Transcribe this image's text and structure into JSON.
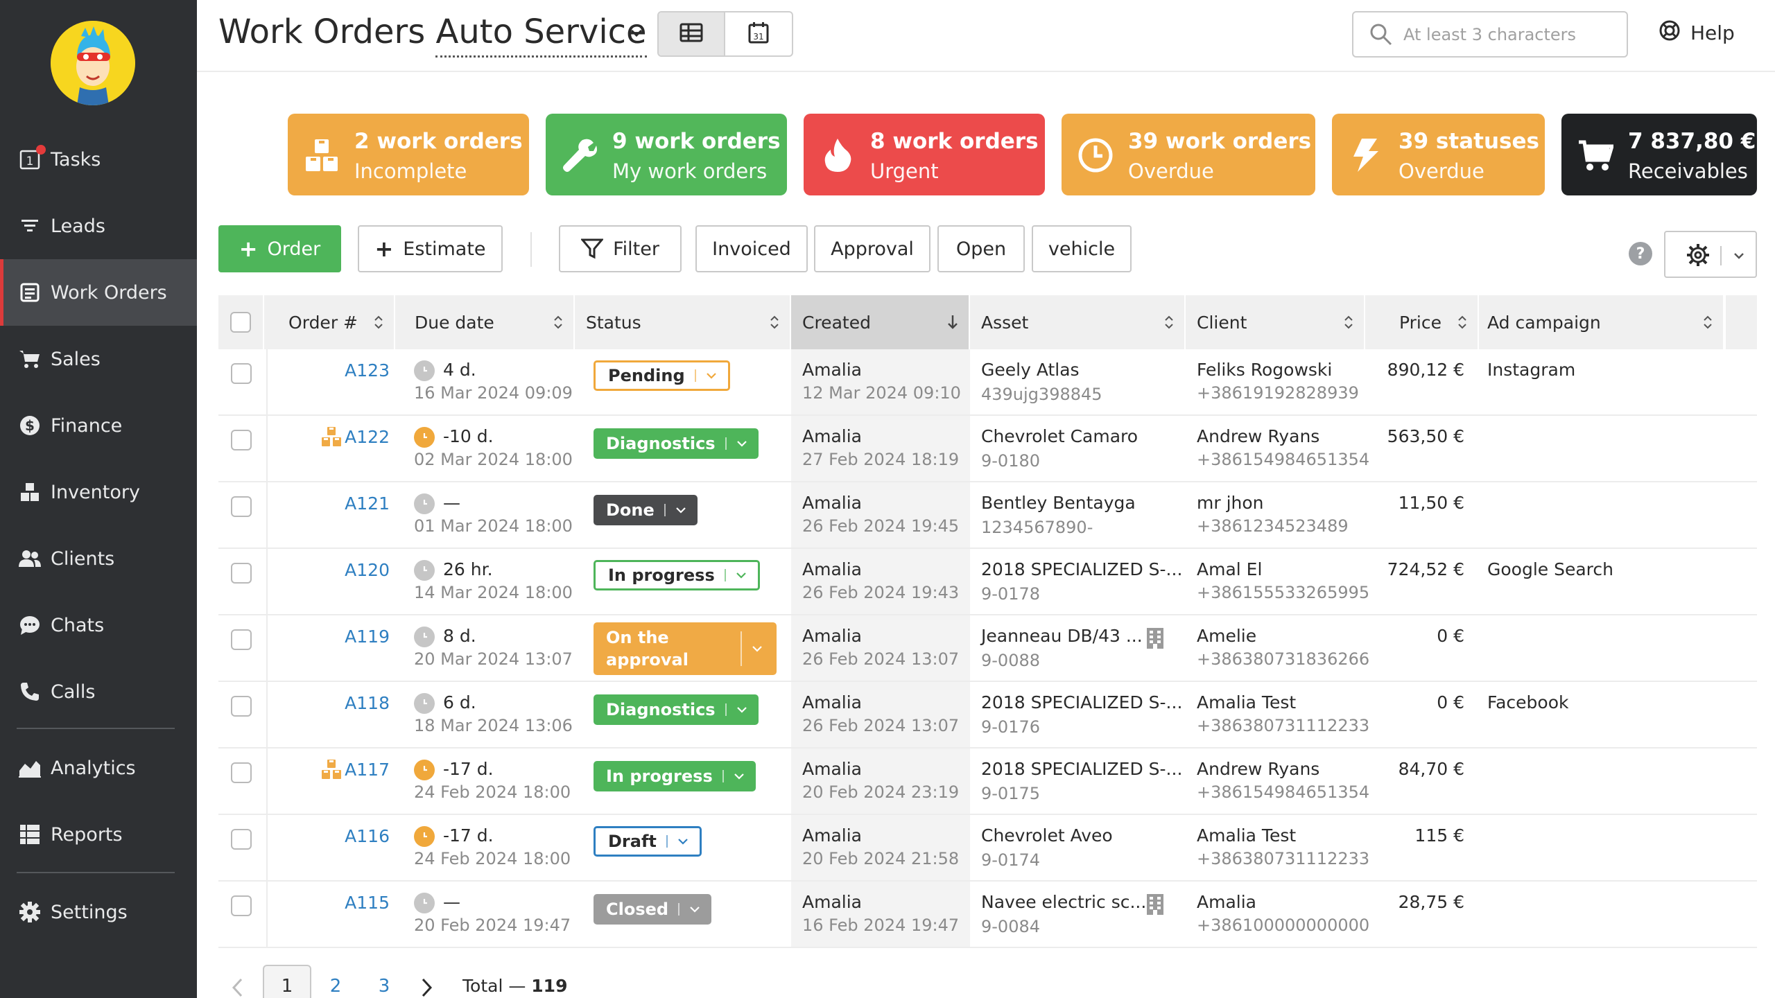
{
  "sidebar": {
    "items": [
      {
        "label": "Tasks",
        "icon": "task-icon",
        "badge_value": "1"
      },
      {
        "label": "Leads",
        "icon": "funnel-icon"
      },
      {
        "label": "Work Orders",
        "icon": "work-orders-icon",
        "active": true
      },
      {
        "label": "Sales",
        "icon": "cart-icon"
      },
      {
        "label": "Finance",
        "icon": "dollar-icon"
      },
      {
        "label": "Inventory",
        "icon": "boxes-icon"
      },
      {
        "label": "Clients",
        "icon": "users-icon"
      },
      {
        "label": "Chats",
        "icon": "chat-icon"
      },
      {
        "label": "Calls",
        "icon": "phone-icon"
      },
      {
        "label": "Analytics",
        "icon": "analytics-icon"
      },
      {
        "label": "Reports",
        "icon": "reports-icon"
      },
      {
        "label": "Settings",
        "icon": "gear-icon"
      }
    ]
  },
  "header": {
    "title_prefix": "Work Orders ",
    "title_dropdown": "Auto Service",
    "search_placeholder": "At least 3 characters",
    "help_label": "Help"
  },
  "kpis": [
    {
      "value": "2 work orders",
      "label": "Incomplete",
      "color": "#f0aa45",
      "icon": "boxes-icon"
    },
    {
      "value": "9 work orders",
      "label": "My work orders",
      "color": "#52b75a",
      "icon": "wrench-icon"
    },
    {
      "value": "8 work orders",
      "label": "Urgent",
      "color": "#ec4b4b",
      "icon": "fire-icon"
    },
    {
      "value": "39 work orders",
      "label": "Overdue",
      "color": "#f0aa45",
      "icon": "clock-icon"
    },
    {
      "value": "39 statuses",
      "label": "Overdue",
      "color": "#f0aa45",
      "icon": "lightning-icon"
    },
    {
      "value": "7 837,80 €",
      "label": "Receivables",
      "color": "#202224",
      "icon": "cart-icon"
    }
  ],
  "toolbar": {
    "order_label": "Order",
    "estimate_label": "Estimate",
    "filter_label": "Filter",
    "quick_filters": [
      "Invoiced",
      "Approval",
      "Open",
      "vehicle"
    ],
    "help_q": "?"
  },
  "table": {
    "columns": {
      "order": "Order #",
      "due": "Due date",
      "status": "Status",
      "created": "Created",
      "asset": "Asset",
      "client": "Client",
      "price": "Price",
      "campaign": "Ad campaign"
    },
    "rows": [
      {
        "order": "A123",
        "boxes": false,
        "clock": "gray",
        "due": "4 d.",
        "due_date": "16 Mar 2024 09:09",
        "status": "Pending",
        "status_style": "pending",
        "created_by": "Amalia",
        "created_date": "12 Mar 2024 09:10",
        "asset": "Geely Atlas",
        "asset_id": "439ujg398845",
        "building": false,
        "client": "Feliks Rogowski",
        "phone": "+38619192828939",
        "price": "890,12 €",
        "campaign": "Instagram"
      },
      {
        "order": "A122",
        "boxes": true,
        "clock": "amber",
        "due": "-10 d.",
        "due_date": "02 Mar 2024 18:00",
        "status": "Diagnostics",
        "status_style": "diag",
        "created_by": "Amalia",
        "created_date": "27 Feb 2024 18:19",
        "asset": "Chevrolet Camaro",
        "asset_id": "9-0180",
        "building": false,
        "client": "Andrew Ryans",
        "phone": "+386154984651354",
        "price": "563,50 €",
        "campaign": ""
      },
      {
        "order": "A121",
        "boxes": false,
        "clock": "gray",
        "due": "—",
        "due_date": "01 Mar 2024 18:00",
        "status": "Done",
        "status_style": "done",
        "created_by": "Amalia",
        "created_date": "26 Feb 2024 19:45",
        "asset": "Bentley Bentayga",
        "asset_id": "1234567890-",
        "building": false,
        "client": "mr jhon",
        "phone": "+3861234523489",
        "price": "11,50 €",
        "campaign": ""
      },
      {
        "order": "A120",
        "boxes": false,
        "clock": "gray",
        "due": "26 hr.",
        "due_date": "14 Mar 2024 18:00",
        "status": "In progress",
        "status_style": "progress",
        "created_by": "Amalia",
        "created_date": "26 Feb 2024 19:43",
        "asset": "2018 SPECIALIZED S-...",
        "asset_id": "9-0178",
        "building": false,
        "client": "Amal El",
        "phone": "+386155533265995",
        "price": "724,52 €",
        "campaign": "Google Search"
      },
      {
        "order": "A119",
        "boxes": false,
        "clock": "gray",
        "due": "8 d.",
        "due_date": "20 Mar 2024 13:07",
        "status": "On the approval",
        "status_line1": "On the",
        "status_line2": "approval",
        "status_style": "approval",
        "created_by": "Amalia",
        "created_date": "26 Feb 2024 13:07",
        "asset": "Jeanneau DB/43 ...",
        "asset_id": "9-0088",
        "building": true,
        "client": "Amelie",
        "phone": "+386380731836266",
        "price": "0 €",
        "campaign": ""
      },
      {
        "order": "A118",
        "boxes": false,
        "clock": "gray",
        "due": "6 d.",
        "due_date": "18 Mar 2024 13:06",
        "status": "Diagnostics",
        "status_style": "diag",
        "created_by": "Amalia",
        "created_date": "26 Feb 2024 13:07",
        "asset": "2018 SPECIALIZED S-...",
        "asset_id": "9-0176",
        "building": false,
        "client": "Amalia Test",
        "phone": "+386380731112233",
        "price": "0 €",
        "campaign": "Facebook"
      },
      {
        "order": "A117",
        "boxes": true,
        "clock": "amber",
        "due": "-17 d.",
        "due_date": "24 Feb 2024 18:00",
        "status": "In progress",
        "status_style": "progress-fill",
        "created_by": "Amalia",
        "created_date": "20 Feb 2024 23:19",
        "asset": "2018 SPECIALIZED S-...",
        "asset_id": "9-0175",
        "building": false,
        "client": "Andrew Ryans",
        "phone": "+386154984651354",
        "price": "84,70 €",
        "campaign": ""
      },
      {
        "order": "A116",
        "boxes": false,
        "clock": "amber",
        "due": "-17 d.",
        "due_date": "24 Feb 2024 18:00",
        "status": "Draft",
        "status_style": "draft",
        "created_by": "Amalia",
        "created_date": "20 Feb 2024 21:58",
        "asset": "Chevrolet Aveo",
        "asset_id": "9-0174",
        "building": false,
        "client": "Amalia Test",
        "phone": "+386380731112233",
        "price": "115 €",
        "campaign": ""
      },
      {
        "order": "A115",
        "boxes": false,
        "clock": "gray",
        "due": "—",
        "due_date": "20 Feb 2024 19:47",
        "status": "Closed",
        "status_style": "closed",
        "created_by": "Amalia",
        "created_date": "16 Feb 2024 19:47",
        "asset": "Navee electric sc...",
        "asset_id": "9-0084",
        "building": true,
        "client": "Amalia",
        "phone": "+386100000000000",
        "price": "28,75 €",
        "campaign": ""
      }
    ]
  },
  "pagination": {
    "pages": [
      "1",
      "2",
      "3"
    ],
    "current": "1",
    "total_label": "Total — ",
    "total_value": "119"
  }
}
